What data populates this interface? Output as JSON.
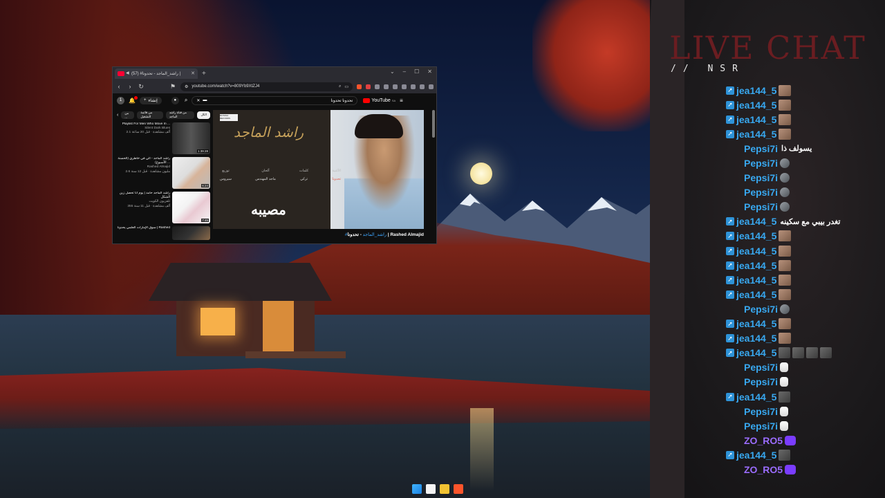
{
  "browser": {
    "tab_title": "(57) #راشد_الماجد - تحدونا |",
    "url": "youtube.com/watch?v=809Yb9XtZJ4",
    "youtube": {
      "avatar_letter": "1",
      "create_label": "إنشاء",
      "search_query": "تحدونا تحدونا",
      "logo_text": "YouTube",
      "logo_sup": "SA",
      "chips": [
        "الكل",
        "من قناة راشد الماجد",
        "من قائمة التشغيل",
        "من ..."
      ],
      "recommendations": [
        {
          "title": "Playlist For Men Who Move In ...",
          "channel": "Silent Dark Blues",
          "stats": "2.1 ألف مشاهدة · قبل 20 ساعة",
          "duration": "1:39:28"
        },
        {
          "title": "راشد الماجد - الي في خاطري (الحسنة الأسبوع) ...",
          "channel": "Rashed Almajid",
          "stats": "2.6 مليون مشاهدة · قبل 12 سنة",
          "duration": "6:24"
        },
        {
          "title": "راشد الماجد حامد | يوم أنا تحصل زين الشكل",
          "channel": "تلفزيون الكويت",
          "stats": "355 ألف مشاهدة · قبل 11 سنة",
          "duration": "7:45"
        },
        {
          "title": "سوق الإمارات العلمي يحدونا | Rashed",
          "channel": "",
          "stats": "",
          "duration": ""
        }
      ],
      "video": {
        "calligraphy": "راشد الماجد",
        "credits": [
          {
            "heading": "الأغنية",
            "value": "تحدونا"
          },
          {
            "heading": "كلمات",
            "value": "تركي"
          },
          {
            "heading": "ألحان",
            "value": "ماجد المهندس"
          },
          {
            "heading": "توزيع",
            "value": "سيروس"
          }
        ],
        "overlay_title": "مصيبه",
        "logo": "ROTANA RECORDS"
      },
      "video_title_channel": "#راشد_الماجد",
      "video_title_rest": " - تحدونا | Rashed Almajid"
    }
  },
  "chat": {
    "title": "LIVE CHAT",
    "subtitle": "// NSR",
    "messages": [
      {
        "user": "jea144_5",
        "color": "blue",
        "badge": true,
        "text": "",
        "emotes": [
          "face"
        ]
      },
      {
        "user": "jea144_5",
        "color": "blue",
        "badge": true,
        "text": "",
        "emotes": [
          "face"
        ]
      },
      {
        "user": "jea144_5",
        "color": "blue",
        "badge": true,
        "text": "",
        "emotes": [
          "face"
        ]
      },
      {
        "user": "jea144_5",
        "color": "blue",
        "badge": true,
        "text": "",
        "emotes": [
          "face"
        ]
      },
      {
        "user": "Pepsi7i",
        "color": "blue",
        "badge": false,
        "text": "يسولف ذا",
        "emotes": []
      },
      {
        "user": "Pepsi7i",
        "color": "blue",
        "badge": false,
        "text": "",
        "emotes": [
          "bird"
        ]
      },
      {
        "user": "Pepsi7i",
        "color": "blue",
        "badge": false,
        "text": "",
        "emotes": [
          "bird"
        ]
      },
      {
        "user": "Pepsi7i",
        "color": "blue",
        "badge": false,
        "text": "",
        "emotes": [
          "bird"
        ]
      },
      {
        "user": "Pepsi7i",
        "color": "blue",
        "badge": false,
        "text": "",
        "emotes": [
          "bird"
        ]
      },
      {
        "user": "jea144_5",
        "color": "blue",
        "badge": true,
        "text": "تغدر بيبي مع سكينه",
        "emotes": []
      },
      {
        "user": "jea144_5",
        "color": "blue",
        "badge": true,
        "text": "",
        "emotes": [
          "face"
        ]
      },
      {
        "user": "jea144_5",
        "color": "blue",
        "badge": true,
        "text": "",
        "emotes": [
          "face"
        ]
      },
      {
        "user": "jea144_5",
        "color": "blue",
        "badge": true,
        "text": "",
        "emotes": [
          "face"
        ]
      },
      {
        "user": "jea144_5",
        "color": "blue",
        "badge": true,
        "text": "",
        "emotes": [
          "face"
        ]
      },
      {
        "user": "jea144_5",
        "color": "blue",
        "badge": true,
        "text": "",
        "emotes": [
          "face"
        ]
      },
      {
        "user": "Pepsi7i",
        "color": "blue",
        "badge": false,
        "text": "",
        "emotes": [
          "bird"
        ]
      },
      {
        "user": "jea144_5",
        "color": "blue",
        "badge": true,
        "text": "",
        "emotes": [
          "face"
        ]
      },
      {
        "user": "jea144_5",
        "color": "blue",
        "badge": true,
        "text": "",
        "emotes": [
          "face"
        ]
      },
      {
        "user": "jea144_5",
        "color": "blue",
        "badge": true,
        "text": "",
        "emotes": [
          "gray",
          "gray",
          "gray",
          "gray"
        ]
      },
      {
        "user": "Pepsi7i",
        "color": "blue",
        "badge": false,
        "text": "",
        "emotes": [
          "hand"
        ]
      },
      {
        "user": "Pepsi7i",
        "color": "blue",
        "badge": false,
        "text": "",
        "emotes": [
          "hand"
        ]
      },
      {
        "user": "jea144_5",
        "color": "blue",
        "badge": true,
        "text": "",
        "emotes": [
          "gray"
        ]
      },
      {
        "user": "Pepsi7i",
        "color": "blue",
        "badge": false,
        "text": "",
        "emotes": [
          "hand"
        ]
      },
      {
        "user": "Pepsi7i",
        "color": "blue",
        "badge": false,
        "text": "",
        "emotes": [
          "hand"
        ]
      },
      {
        "user": "ZO_RO5",
        "color": "purple",
        "badge": false,
        "text": "",
        "emotes": [
          "purp"
        ]
      },
      {
        "user": "jea144_5",
        "color": "blue",
        "badge": true,
        "text": "",
        "emotes": [
          "gray"
        ]
      },
      {
        "user": "ZO_RO5",
        "color": "purple",
        "badge": false,
        "text": "",
        "emotes": [
          "purp"
        ]
      }
    ]
  },
  "colors": {
    "chat_title": "#6a1d21",
    "user_blue": "#38a8f0",
    "user_purple": "#9b6cff",
    "twitch_badge": "#2e93d8"
  },
  "taskbar": [
    "start-icon",
    "store-icon",
    "folder-icon",
    "brave-icon"
  ]
}
